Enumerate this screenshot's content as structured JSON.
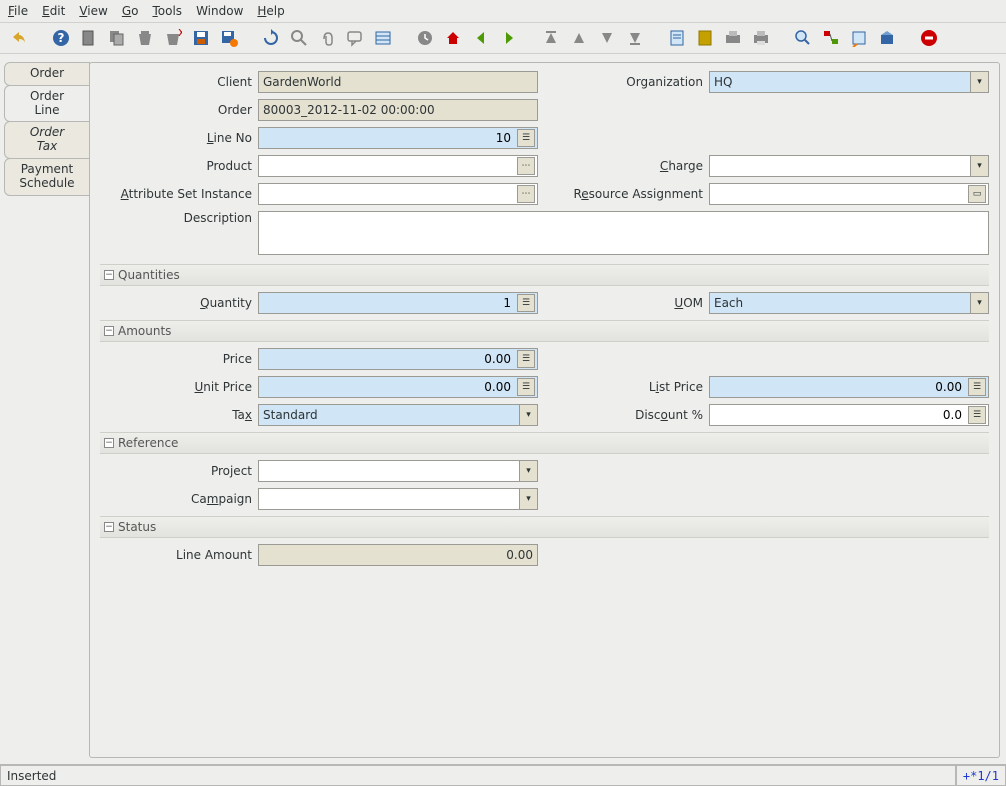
{
  "menu": {
    "file": "File",
    "edit": "Edit",
    "view": "View",
    "go": "Go",
    "tools": "Tools",
    "window": "Window",
    "help": "Help"
  },
  "tabs": {
    "order": "Order",
    "order_line": "Order Line",
    "order_tax": "Order Tax",
    "payment_schedule": "Payment Schedule"
  },
  "labels": {
    "client": "Client",
    "organization": "Organization",
    "order": "Order",
    "line_no": "Line No",
    "product": "Product",
    "charge": "Charge",
    "attr_set": "Attribute Set Instance",
    "resource_assign": "Resource Assignment",
    "description": "Description",
    "quantities": "Quantities",
    "quantity": "Quantity",
    "uom": "UOM",
    "amounts": "Amounts",
    "price": "Price",
    "unit_price": "Unit Price",
    "list_price": "List Price",
    "tax": "Tax",
    "discount": "Discount %",
    "reference": "Reference",
    "project": "Project",
    "campaign": "Campaign",
    "status": "Status",
    "line_amount": "Line Amount"
  },
  "values": {
    "client": "GardenWorld",
    "organization": "HQ",
    "order": "80003_2012-11-02 00:00:00",
    "line_no": "10",
    "product": "",
    "charge": "",
    "attr_set": "",
    "resource_assign": "",
    "description": "",
    "quantity": "1",
    "uom": "Each",
    "price": "0.00",
    "unit_price": "0.00",
    "list_price": "0.00",
    "tax": "Standard",
    "discount": "0.0",
    "project": "",
    "campaign": "",
    "line_amount": "0.00"
  },
  "status": {
    "message": "Inserted",
    "pager": "+*1/1"
  },
  "glyphs": {
    "minus": "−",
    "down": "▾",
    "calc": "☰"
  }
}
